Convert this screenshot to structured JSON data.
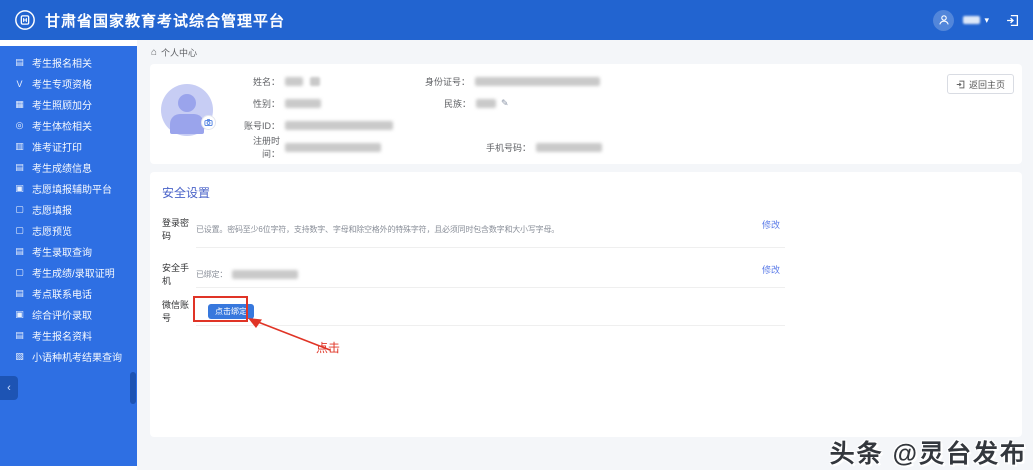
{
  "header": {
    "title": "甘肃省国家教育考试综合管理平台",
    "caret": "▾"
  },
  "sidebar": {
    "collapse_glyph": "‹",
    "items": [
      {
        "glyph": "▤",
        "label": "考生报名相关"
      },
      {
        "glyph": "V",
        "label": "考生专项资格"
      },
      {
        "glyph": "▦",
        "label": "考生照顾加分"
      },
      {
        "glyph": "◎",
        "label": "考生体检相关"
      },
      {
        "glyph": "▥",
        "label": "准考证打印"
      },
      {
        "glyph": "▤",
        "label": "考生成绩信息"
      },
      {
        "glyph": "▣",
        "label": "志愿填报辅助平台"
      },
      {
        "glyph": "▢",
        "label": "志愿填报"
      },
      {
        "glyph": "▢",
        "label": "志愿预览"
      },
      {
        "glyph": "▤",
        "label": "考生录取查询"
      },
      {
        "glyph": "▢",
        "label": "考生成绩/录取证明"
      },
      {
        "glyph": "▤",
        "label": "考点联系电话"
      },
      {
        "glyph": "▣",
        "label": "综合评价录取"
      },
      {
        "glyph": "▤",
        "label": "考生报名资料"
      },
      {
        "glyph": "▧",
        "label": "小语种机考结果查询"
      }
    ]
  },
  "breadcrumb": {
    "home_glyph": "⌂",
    "label": "个人中心"
  },
  "profile": {
    "name_label": "姓名：",
    "id_label": "身份证号：",
    "gender_label": "性别：",
    "ethnic_label": "民族：",
    "edit_glyph": "✎",
    "account_label": "账号ID：",
    "regtime_label": "注册时间：",
    "phone_label": "手机号码：",
    "back_home_label": "返回主页"
  },
  "security": {
    "title": "安全设置",
    "rows": [
      {
        "label": "登录密码",
        "desc": "已设置。密码至少6位字符，支持数字、字母和除空格外的特殊字符，且必须同时包含数字和大小写字母。",
        "action": "修改"
      },
      {
        "label": "安全手机",
        "desc": "已绑定：",
        "action": "修改"
      },
      {
        "label": "微信账号",
        "button": "点击绑定"
      }
    ]
  },
  "annotation": {
    "click_label": "点击",
    "color": "#e03426"
  },
  "watermark": {
    "text": "头条 @灵台发布"
  },
  "colors": {
    "header_blue": "#2264d0",
    "sidebar_blue": "#2e6fe3",
    "link_blue": "#5b7be8",
    "title_blue": "#4a63c8",
    "button_blue": "#3778dd",
    "annotation_red": "#e03426",
    "avatar_purple": "#c7cdf4"
  }
}
